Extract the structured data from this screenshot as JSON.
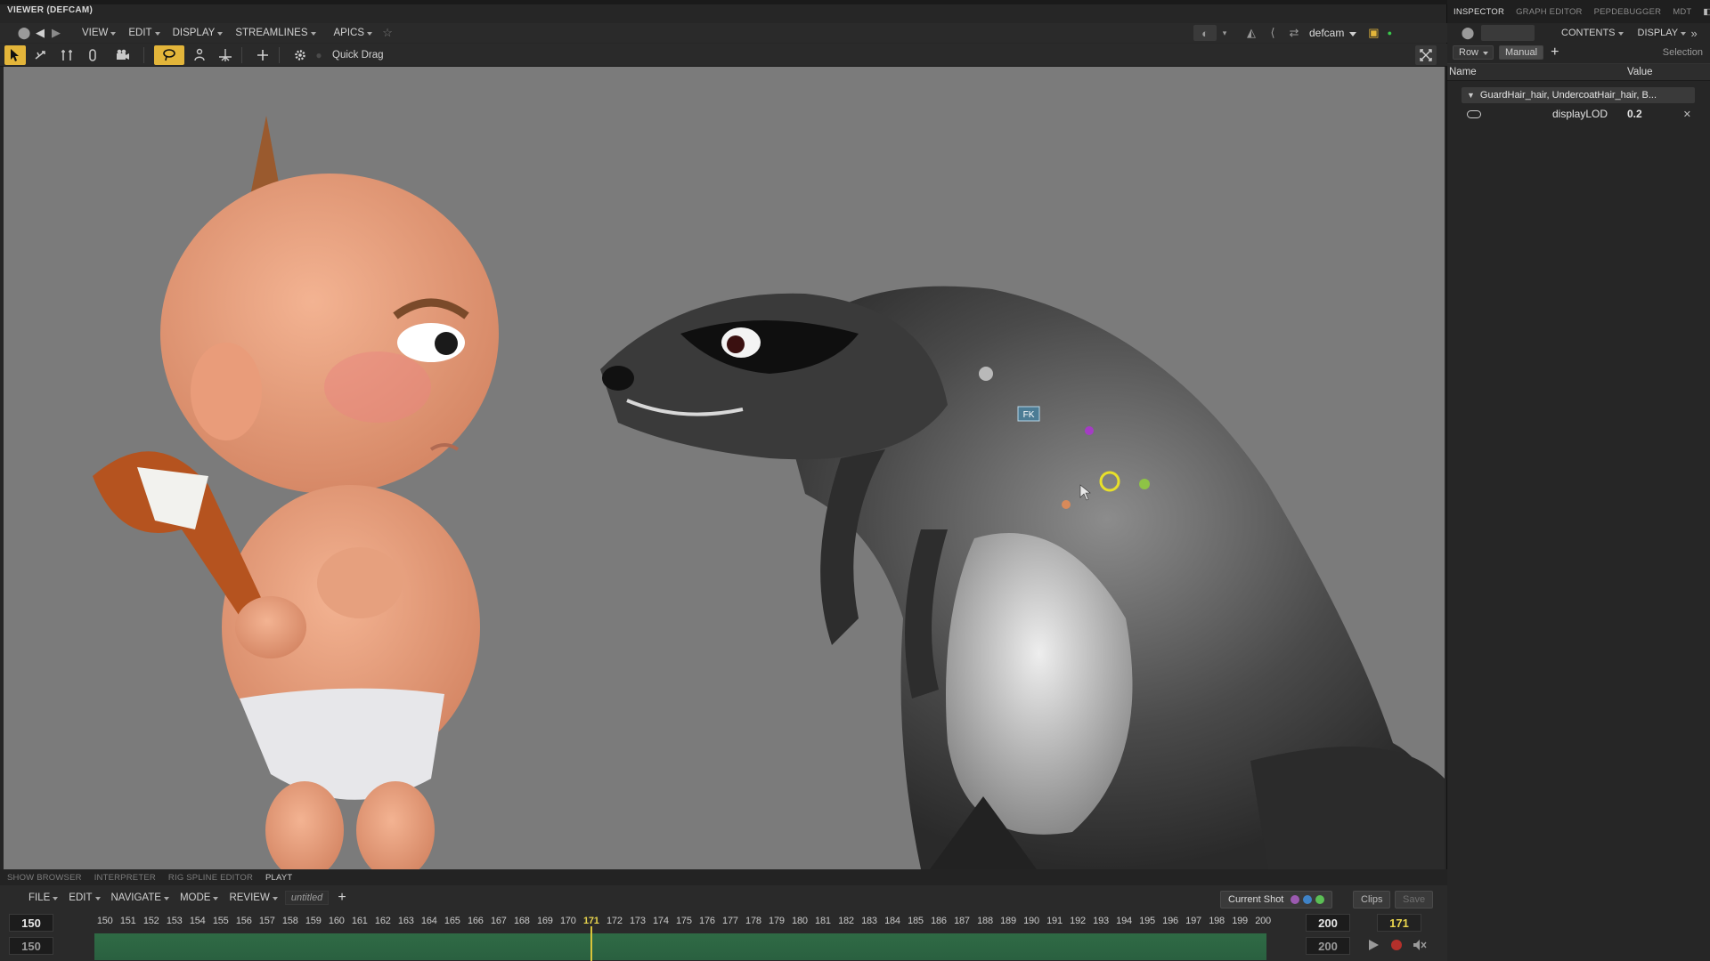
{
  "viewer": {
    "title": "VIEWER (DEFCAM)",
    "menus": [
      "VIEW",
      "EDIT",
      "DISPLAY",
      "STREAMLINES",
      "APICS"
    ],
    "quick_drag_label": "Quick Drag",
    "camera_label": "defcam",
    "manip_fk_label": "FK"
  },
  "inspector": {
    "tabs": [
      "INSPECTOR",
      "GRAPH EDITOR",
      "PEPDEBUGGER",
      "MDT"
    ],
    "contents_label": "CONTENTS",
    "display_label": "DISPLAY",
    "row_label": "Row",
    "manual_label": "Manual",
    "selection_label": "Selection",
    "col_name": "Name",
    "col_value": "Value",
    "group_label": "GuardHair_hair, UndercoatHair_hair, B...",
    "attr_name": "displayLOD",
    "attr_value": "0.2"
  },
  "bottom": {
    "tabs": [
      "SHOW BROWSER",
      "INTERPRETER",
      "RIG SPLINE EDITOR",
      "PLAYT"
    ],
    "menus": [
      "FILE",
      "EDIT",
      "NAVIGATE",
      "MODE",
      "REVIEW"
    ],
    "untitled_label": "untitled",
    "current_shot_label": "Current Shot",
    "clips_label": "Clips",
    "save_label": "Save",
    "start_frame": "150",
    "start_frame_range": "150",
    "end_frame": "200",
    "end_frame_range": "200",
    "current_frame": "171"
  },
  "timeline": {
    "start": 150,
    "end": 200,
    "current": 171
  },
  "colors": {
    "active_tool": "#e3b53a",
    "timeline_track": "#2f6b45",
    "playhead": "#d9c43a",
    "shot_dots": [
      "#9b5ab0",
      "#3f83c7",
      "#5bbf55"
    ]
  }
}
